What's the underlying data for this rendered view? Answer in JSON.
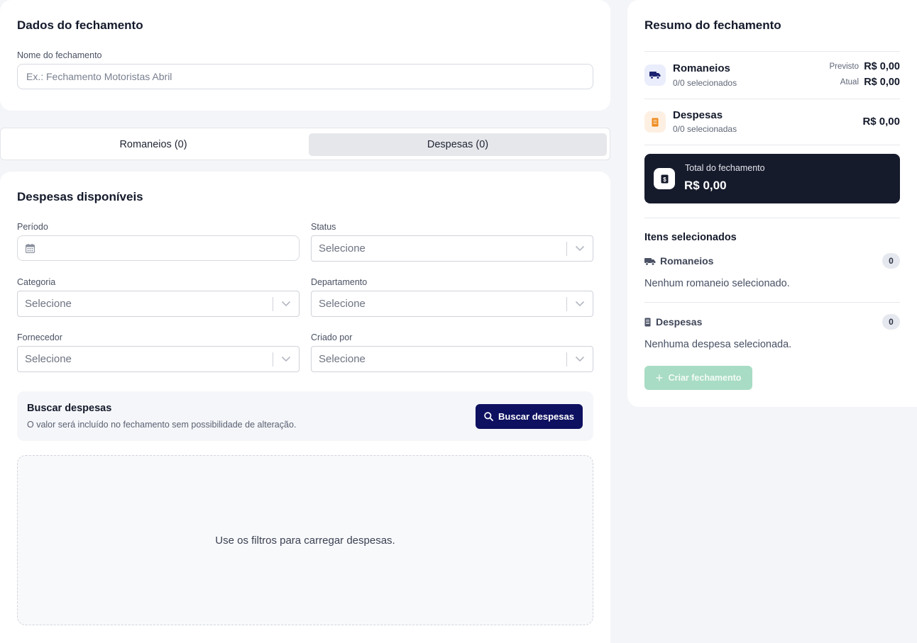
{
  "closing_data": {
    "title": "Dados do fechamento",
    "name_label": "Nome do fechamento",
    "name_value": "",
    "name_placeholder": "Ex.: Fechamento Motoristas Abril"
  },
  "tabs": [
    {
      "label": "Romaneios (0)",
      "active": false
    },
    {
      "label": "Despesas (0)",
      "active": true
    }
  ],
  "expenses": {
    "title": "Despesas disponíveis",
    "filters": {
      "period": {
        "label": "Período",
        "value": ""
      },
      "status": {
        "label": "Status",
        "value": "Selecione"
      },
      "category": {
        "label": "Categoria",
        "value": "Selecione"
      },
      "department": {
        "label": "Departamento",
        "value": "Selecione"
      },
      "supplier": {
        "label": "Fornecedor",
        "value": "Selecione"
      },
      "created_by": {
        "label": "Criado por",
        "value": "Selecione"
      }
    },
    "search": {
      "title": "Buscar despesas",
      "description": "O valor será incluído no fechamento sem possibilidade de alteração.",
      "button_label": "Buscar despesas"
    },
    "empty_message": "Use os filtros para carregar despesas."
  },
  "summary": {
    "title": "Resumo do fechamento",
    "romaneios": {
      "name": "Romaneios",
      "selected": "0/0 selecionados",
      "forecast_label": "Previsto",
      "forecast_value": "R$ 0,00",
      "current_label": "Atual",
      "current_value": "R$ 0,00"
    },
    "despesas": {
      "name": "Despesas",
      "selected": "0/0 selecionadas",
      "value": "R$ 0,00"
    },
    "total": {
      "label": "Total do fechamento",
      "value": "R$ 0,00"
    },
    "selected_items": {
      "title": "Itens selecionados",
      "romaneios_label": "Romaneios",
      "romaneios_count": "0",
      "romaneios_empty": "Nenhum romaneio selecionado.",
      "despesas_label": "Despesas",
      "despesas_count": "0",
      "despesas_empty": "Nenhuma despesa selecionada."
    },
    "create_button": "Criar fechamento"
  },
  "colors": {
    "primary": "#0e1160",
    "dark_panel": "#161b2c",
    "create_disabled": "#a8dcc4",
    "truck_bg": "#eaedfb",
    "receipt_bg": "#fdf0e2",
    "receipt_icon": "#ef8a1c"
  }
}
